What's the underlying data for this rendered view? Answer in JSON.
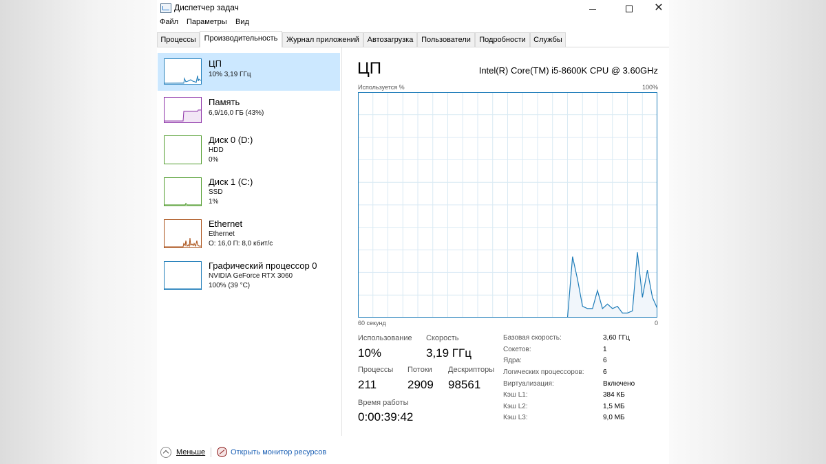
{
  "window": {
    "title": "Диспетчер задач",
    "min_glyph": "—",
    "max_glyph": "☐",
    "close_glyph": "✕"
  },
  "menu": [
    "Файл",
    "Параметры",
    "Вид"
  ],
  "tabs": [
    {
      "label": "Процессы",
      "active": false
    },
    {
      "label": "Производительность",
      "active": true
    },
    {
      "label": "Журнал приложений",
      "active": false
    },
    {
      "label": "Автозагрузка",
      "active": false
    },
    {
      "label": "Пользователи",
      "active": false
    },
    {
      "label": "Подробности",
      "active": false
    },
    {
      "label": "Службы",
      "active": false
    }
  ],
  "resources": [
    {
      "title": "ЦП",
      "line1": "10% 3,19 ГГц",
      "line2": "",
      "color": "#1c7bb8",
      "selected": true
    },
    {
      "title": "Память",
      "line1": "6,9/16,0 ГБ (43%)",
      "line2": "",
      "color": "#8b2fa6",
      "selected": false
    },
    {
      "title": "Диск 0 (D:)",
      "line1": "HDD",
      "line2": "0%",
      "color": "#4d9a29",
      "selected": false
    },
    {
      "title": "Диск 1 (C:)",
      "line1": "SSD",
      "line2": "1%",
      "color": "#4d9a29",
      "selected": false
    },
    {
      "title": "Ethernet",
      "line1": "Ethernet",
      "line2": "О: 16,0 П: 8,0 кбит/с",
      "color": "#a84d14",
      "selected": false
    },
    {
      "title": "Графический процессор 0",
      "line1": "NVIDIA GeForce RTX 3060",
      "line2": "100% (39 °C)",
      "color": "#1c7bb8",
      "selected": false
    }
  ],
  "cpu": {
    "title": "ЦП",
    "model": "Intel(R) Core(TM) i5-8600K CPU @ 3.60GHz",
    "y_label": "Используется %",
    "y_max_label": "100%",
    "x_label": "60 секунд",
    "x_end_label": "0",
    "line_color": "#1c7bb8",
    "fill_color": "#f1f6fb",
    "grid_color": "#d9eaf4"
  },
  "stats": {
    "usage_label": "Использование",
    "usage_value": "10%",
    "speed_label": "Скорость",
    "speed_value": "3,19 ГГц",
    "processes_label": "Процессы",
    "processes_value": "211",
    "threads_label": "Потоки",
    "threads_value": "2909",
    "handles_label": "Дескрипторы",
    "handles_value": "98561",
    "uptime_label": "Время работы",
    "uptime_value": "0:00:39:42"
  },
  "details": [
    {
      "label": "Базовая скорость:",
      "value": "3,60 ГГц"
    },
    {
      "label": "Сокетов:",
      "value": "1"
    },
    {
      "label": "Ядра:",
      "value": "6"
    },
    {
      "label": "Логических процессоров:",
      "value": "6"
    },
    {
      "label": "Виртуализация:",
      "value": "Включено"
    },
    {
      "label": "Кэш L1:",
      "value": "384 КБ"
    },
    {
      "label": "Кэш L2:",
      "value": "1,5 МБ"
    },
    {
      "label": "Кэш L3:",
      "value": "9,0 МБ"
    }
  ],
  "footer": {
    "less_label": "Меньше",
    "monitor_label": "Открыть монитор ресурсов"
  },
  "chart_data": {
    "type": "area",
    "ylim": [
      0,
      100
    ],
    "x": [
      18,
      17,
      16,
      15,
      14,
      13,
      12,
      11,
      10,
      9,
      8,
      7,
      6,
      5,
      4,
      3,
      2,
      1,
      0
    ],
    "values": [
      0,
      27,
      17,
      5,
      4,
      4,
      12,
      4,
      6,
      4,
      5,
      2,
      2,
      3,
      29,
      9,
      21,
      9,
      4
    ]
  }
}
